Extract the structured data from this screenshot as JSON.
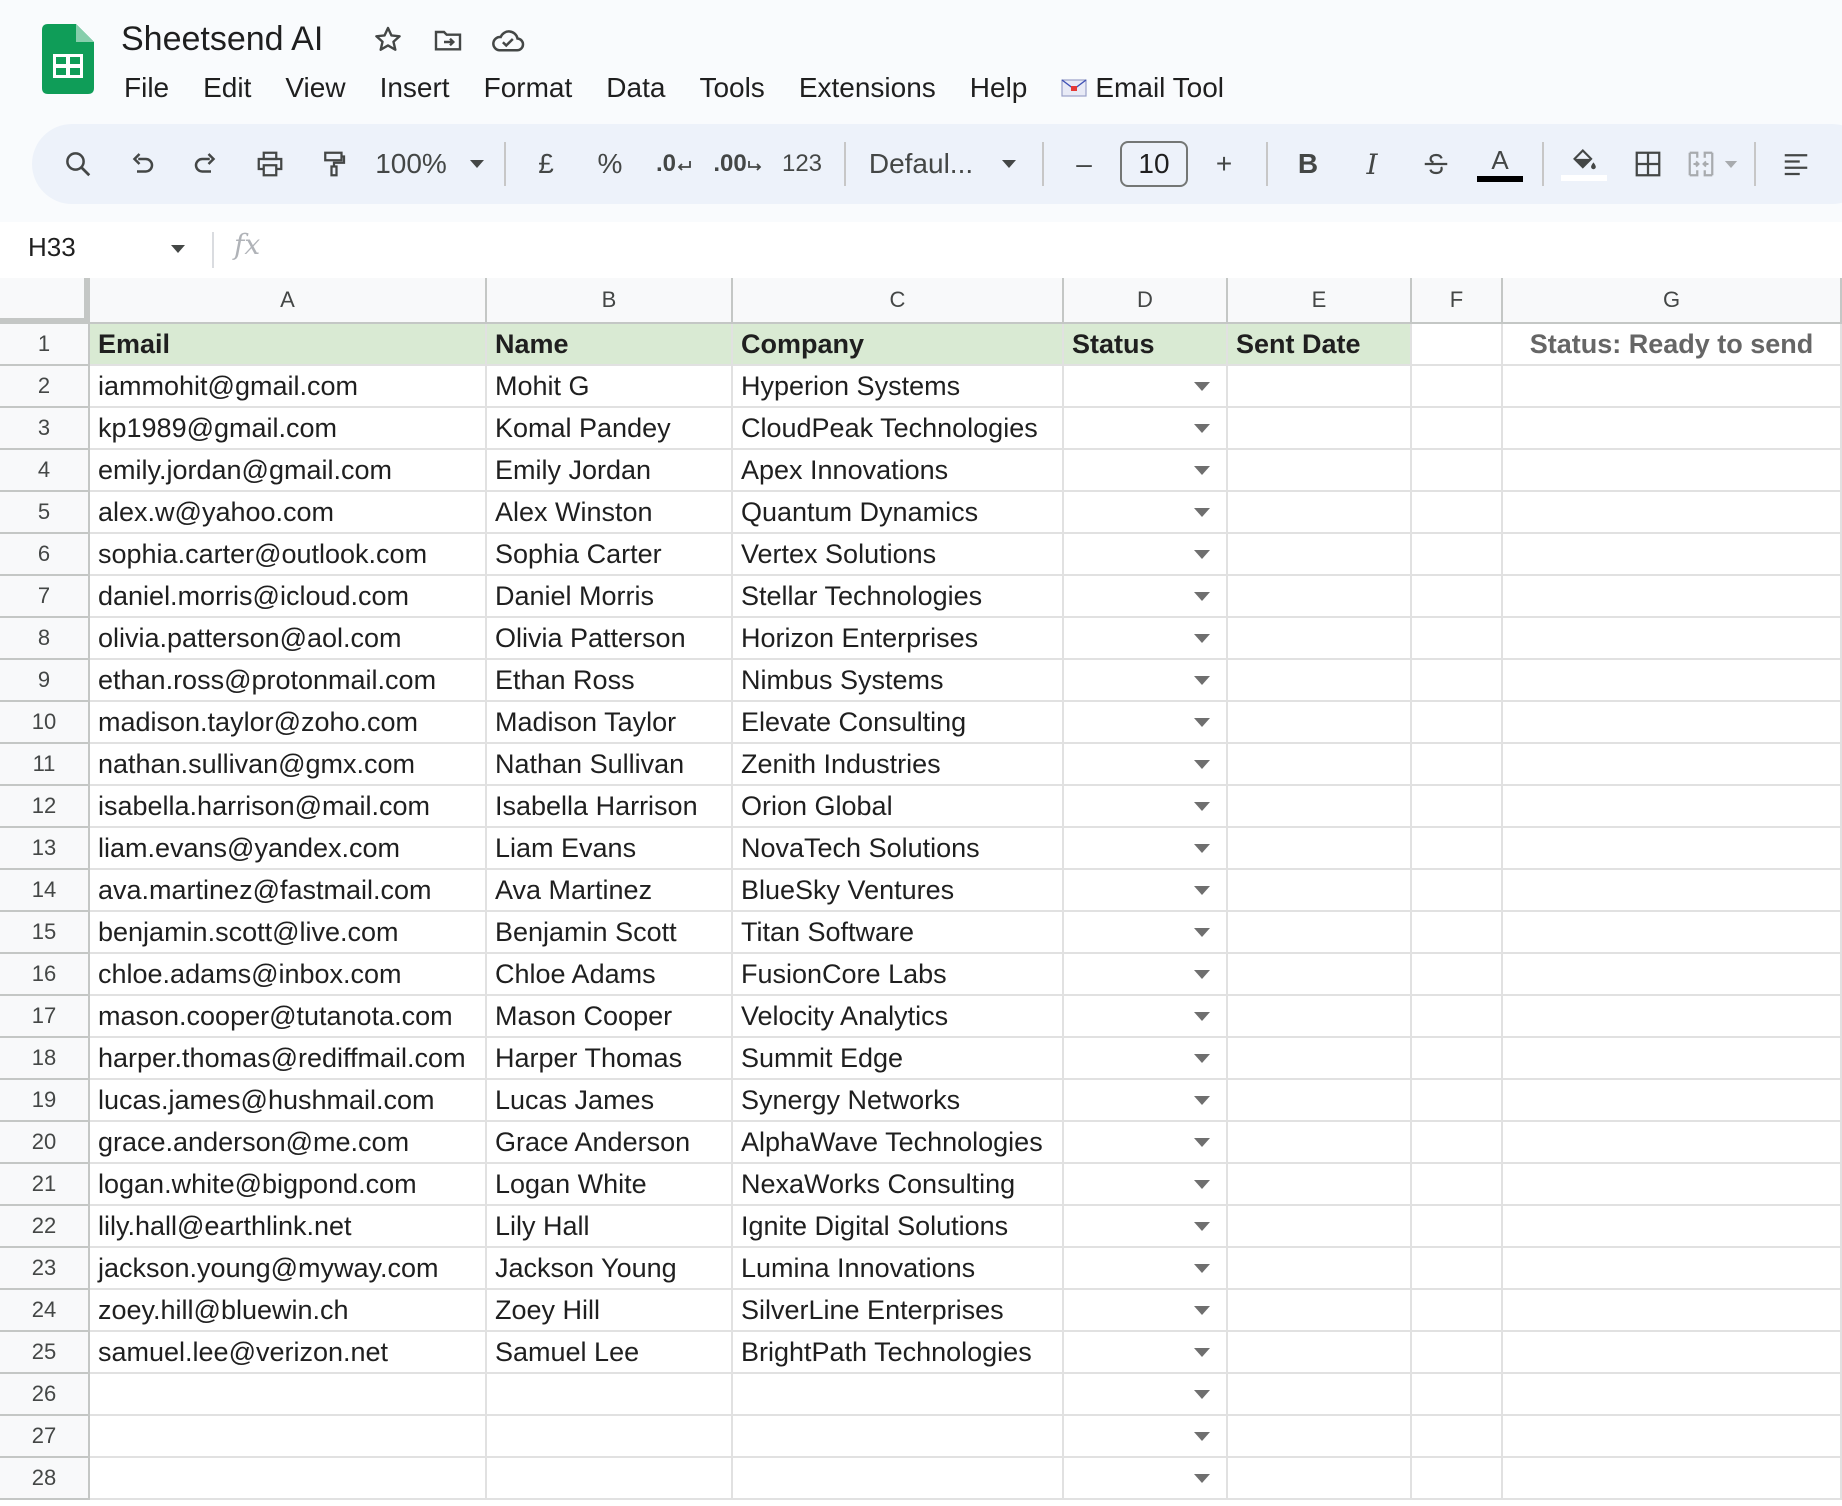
{
  "app": {
    "title": "Sheetsend AI",
    "menu": [
      "File",
      "Edit",
      "View",
      "Insert",
      "Format",
      "Data",
      "Tools",
      "Extensions",
      "Help"
    ],
    "extension_menu": "Email Tool"
  },
  "toolbar": {
    "zoom": "100%",
    "currency": "£",
    "percent": "%",
    "decrease_decimal": ".0",
    "increase_decimal": ".00",
    "number_format": "123",
    "font": "Defaul...",
    "font_size": "10",
    "minus": "–",
    "plus": "+",
    "bold": "B",
    "italic": "I",
    "text_color_letter": "A"
  },
  "formula_bar": {
    "name_box": "H33",
    "fx": "fx",
    "formula": ""
  },
  "grid": {
    "columns": [
      "A",
      "B",
      "C",
      "D",
      "E",
      "F",
      "G"
    ],
    "headers": [
      "Email",
      "Name",
      "Company",
      "Status",
      "Sent Date"
    ],
    "note": "Status: Ready to send",
    "rows": [
      [
        "iammohit@gmail.com",
        "Mohit G",
        "Hyperion Systems"
      ],
      [
        "kp1989@gmail.com",
        "Komal Pandey",
        "CloudPeak Technologies"
      ],
      [
        "emily.jordan@gmail.com",
        "Emily Jordan",
        "Apex Innovations"
      ],
      [
        "alex.w@yahoo.com",
        "Alex Winston",
        "Quantum Dynamics"
      ],
      [
        "sophia.carter@outlook.com",
        "Sophia Carter",
        "Vertex Solutions"
      ],
      [
        "daniel.morris@icloud.com",
        "Daniel Morris",
        "Stellar Technologies"
      ],
      [
        "olivia.patterson@aol.com",
        "Olivia Patterson",
        "Horizon Enterprises"
      ],
      [
        "ethan.ross@protonmail.com",
        "Ethan Ross",
        "Nimbus Systems"
      ],
      [
        "madison.taylor@zoho.com",
        "Madison Taylor",
        "Elevate Consulting"
      ],
      [
        "nathan.sullivan@gmx.com",
        "Nathan Sullivan",
        "Zenith Industries"
      ],
      [
        "isabella.harrison@mail.com",
        "Isabella Harrison",
        "Orion Global"
      ],
      [
        "liam.evans@yandex.com",
        "Liam Evans",
        "NovaTech Solutions"
      ],
      [
        "ava.martinez@fastmail.com",
        "Ava Martinez",
        "BlueSky Ventures"
      ],
      [
        "benjamin.scott@live.com",
        "Benjamin Scott",
        "Titan Software"
      ],
      [
        "chloe.adams@inbox.com",
        "Chloe Adams",
        "FusionCore Labs"
      ],
      [
        "mason.cooper@tutanota.com",
        "Mason Cooper",
        "Velocity Analytics"
      ],
      [
        "harper.thomas@rediffmail.com",
        "Harper Thomas",
        "Summit Edge"
      ],
      [
        "lucas.james@hushmail.com",
        "Lucas James",
        "Synergy Networks"
      ],
      [
        "grace.anderson@me.com",
        "Grace Anderson",
        "AlphaWave Technologies"
      ],
      [
        "logan.white@bigpond.com",
        "Logan White",
        "NexaWorks Consulting"
      ],
      [
        "lily.hall@earthlink.net",
        "Lily Hall",
        "Ignite Digital Solutions"
      ],
      [
        "jackson.young@myway.com",
        "Jackson Young",
        "Lumina Innovations"
      ],
      [
        "zoey.hill@bluewin.ch",
        "Zoey Hill",
        "SilverLine Enterprises"
      ],
      [
        "samuel.lee@verizon.net",
        "Samuel Lee",
        "BrightPath Technologies"
      ],
      [
        "",
        "",
        ""
      ],
      [
        "",
        "",
        ""
      ],
      [
        "",
        "",
        ""
      ]
    ],
    "row_numbers": [
      "1",
      "2",
      "3",
      "4",
      "5",
      "6",
      "7",
      "8",
      "9",
      "10",
      "11",
      "12",
      "13",
      "14",
      "15",
      "16",
      "17",
      "18",
      "19",
      "20",
      "21",
      "22",
      "23",
      "24",
      "25",
      "26",
      "27",
      "28"
    ]
  },
  "colors": {
    "header_fill": "#d9ead3",
    "logo_green": "#0f9d58",
    "toolbar_bg": "#edf2fa"
  },
  "icons": [
    "sheets-logo",
    "star-icon",
    "move-to-folder-icon",
    "cloud-saved-icon",
    "search-icon",
    "undo-icon",
    "redo-icon",
    "print-icon",
    "paint-format-icon",
    "dropdown-arrow-icon",
    "fill-color-icon",
    "borders-icon",
    "merge-cells-icon",
    "align-icon"
  ]
}
